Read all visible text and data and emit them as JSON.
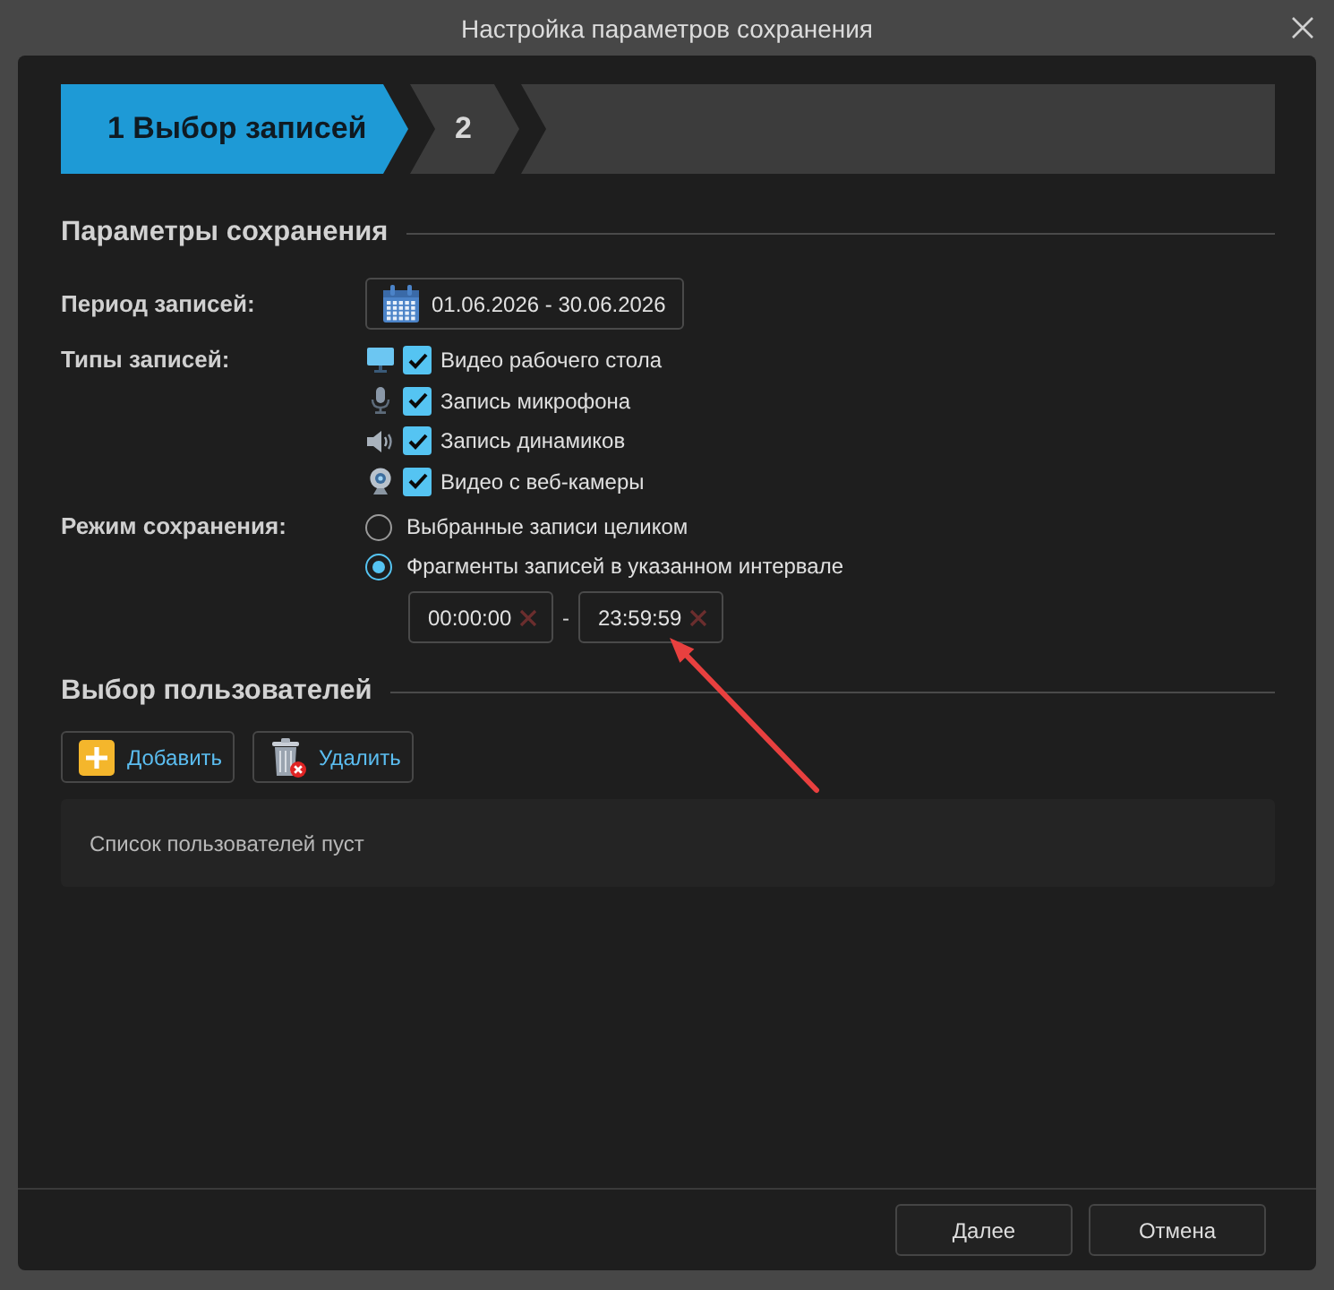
{
  "window": {
    "title": "Настройка параметров сохранения"
  },
  "steps": [
    {
      "label": "1 Выбор записей",
      "selected": true
    },
    {
      "label": "2",
      "selected": false
    }
  ],
  "save_parameters": {
    "heading": "Параметры сохранения",
    "period": {
      "label": "Период записей:",
      "value": "01.06.2026 - 30.06.2026"
    },
    "record_types": {
      "label": "Типы записей:",
      "items": [
        {
          "kind": "desktop",
          "label": "Видео рабочего стола",
          "checked": true
        },
        {
          "kind": "microphone",
          "label": "Запись микрофона",
          "checked": true
        },
        {
          "kind": "speakers",
          "label": "Запись динамиков",
          "checked": true
        },
        {
          "kind": "webcam",
          "label": "Видео с веб-камеры",
          "checked": true
        }
      ]
    },
    "save_mode": {
      "label": "Режим сохранения:",
      "options": [
        {
          "label": "Выбранные записи целиком",
          "selected": false
        },
        {
          "label": "Фрагменты записей в указанном интервале",
          "selected": true
        }
      ],
      "interval": {
        "from": "00:00:00",
        "separator": "-",
        "to": "23:59:59"
      }
    }
  },
  "user_selection": {
    "heading": "Выбор пользователей",
    "buttons": [
      {
        "kind": "add",
        "label": "Добавить"
      },
      {
        "kind": "delete",
        "label": "Удалить"
      }
    ],
    "empty_message": "Список пользователей пуст"
  },
  "annotations": [
    {
      "kind": "arrow"
    }
  ],
  "footer_buttons": [
    "Далее",
    "Отмена"
  ]
}
